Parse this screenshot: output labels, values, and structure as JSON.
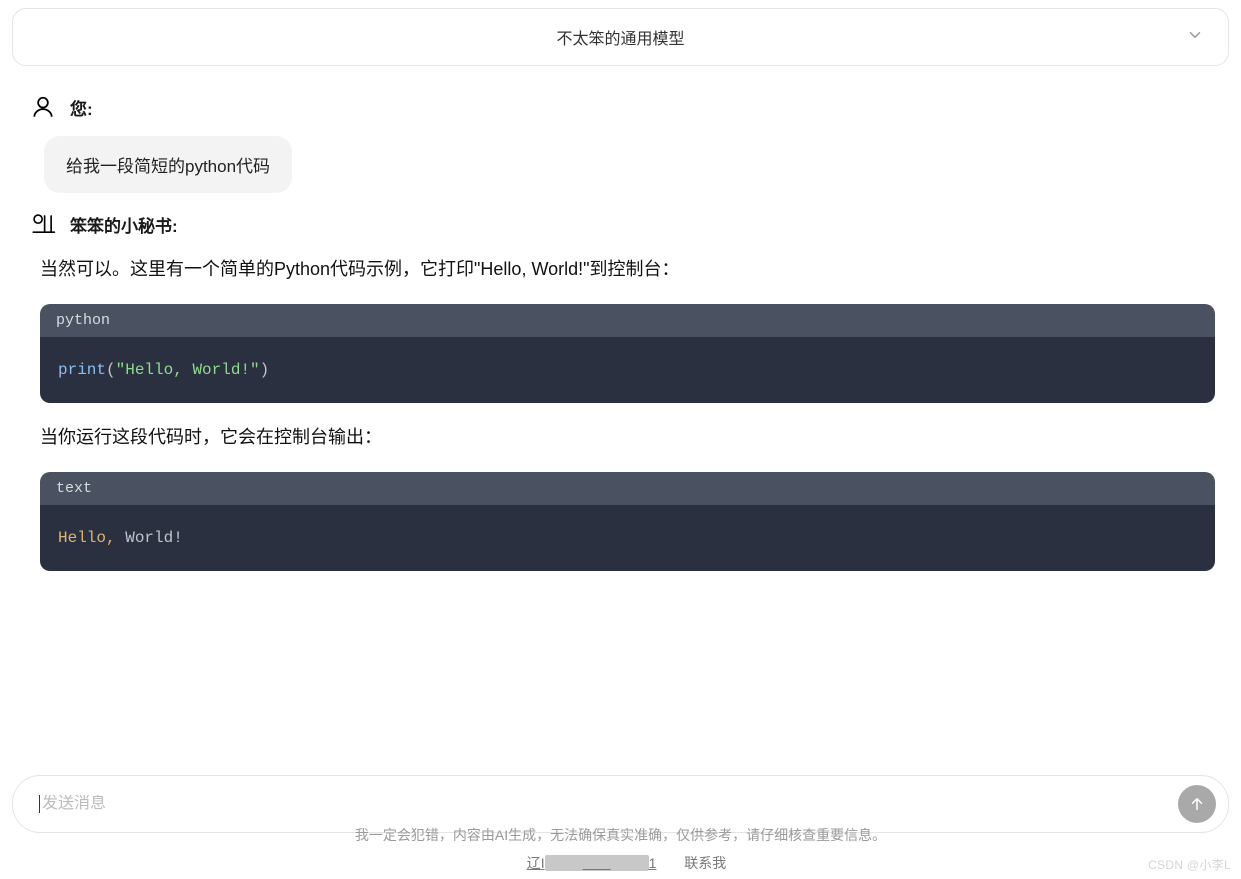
{
  "model_selector": {
    "label": "不太笨的通用模型"
  },
  "chat": {
    "user": {
      "label": "您:",
      "message": "给我一段简短的python代码"
    },
    "assistant": {
      "label": "笨笨的小秘书:",
      "intro": "当然可以。这里有一个简单的Python代码示例，它打印\"Hello, World!\"到控制台：",
      "code1": {
        "lang": "python",
        "fn": "print",
        "open": "(",
        "str": "\"Hello, World!\"",
        "close": ")"
      },
      "explain": "当你运行这段代码时，它会在控制台输出：",
      "code2": {
        "lang": "text",
        "part1": "Hello,",
        "part2": " World!"
      }
    }
  },
  "input": {
    "placeholder": "发送消息"
  },
  "footer": {
    "disclaimer": "我一定会犯错，内容由AI生成，无法确保真实准确，仅供参考，请仔细核查重要信息。",
    "license_prefix": "辽I",
    "license_suffix": "1",
    "contact": "联系我"
  },
  "watermark": "CSDN @小李L"
}
